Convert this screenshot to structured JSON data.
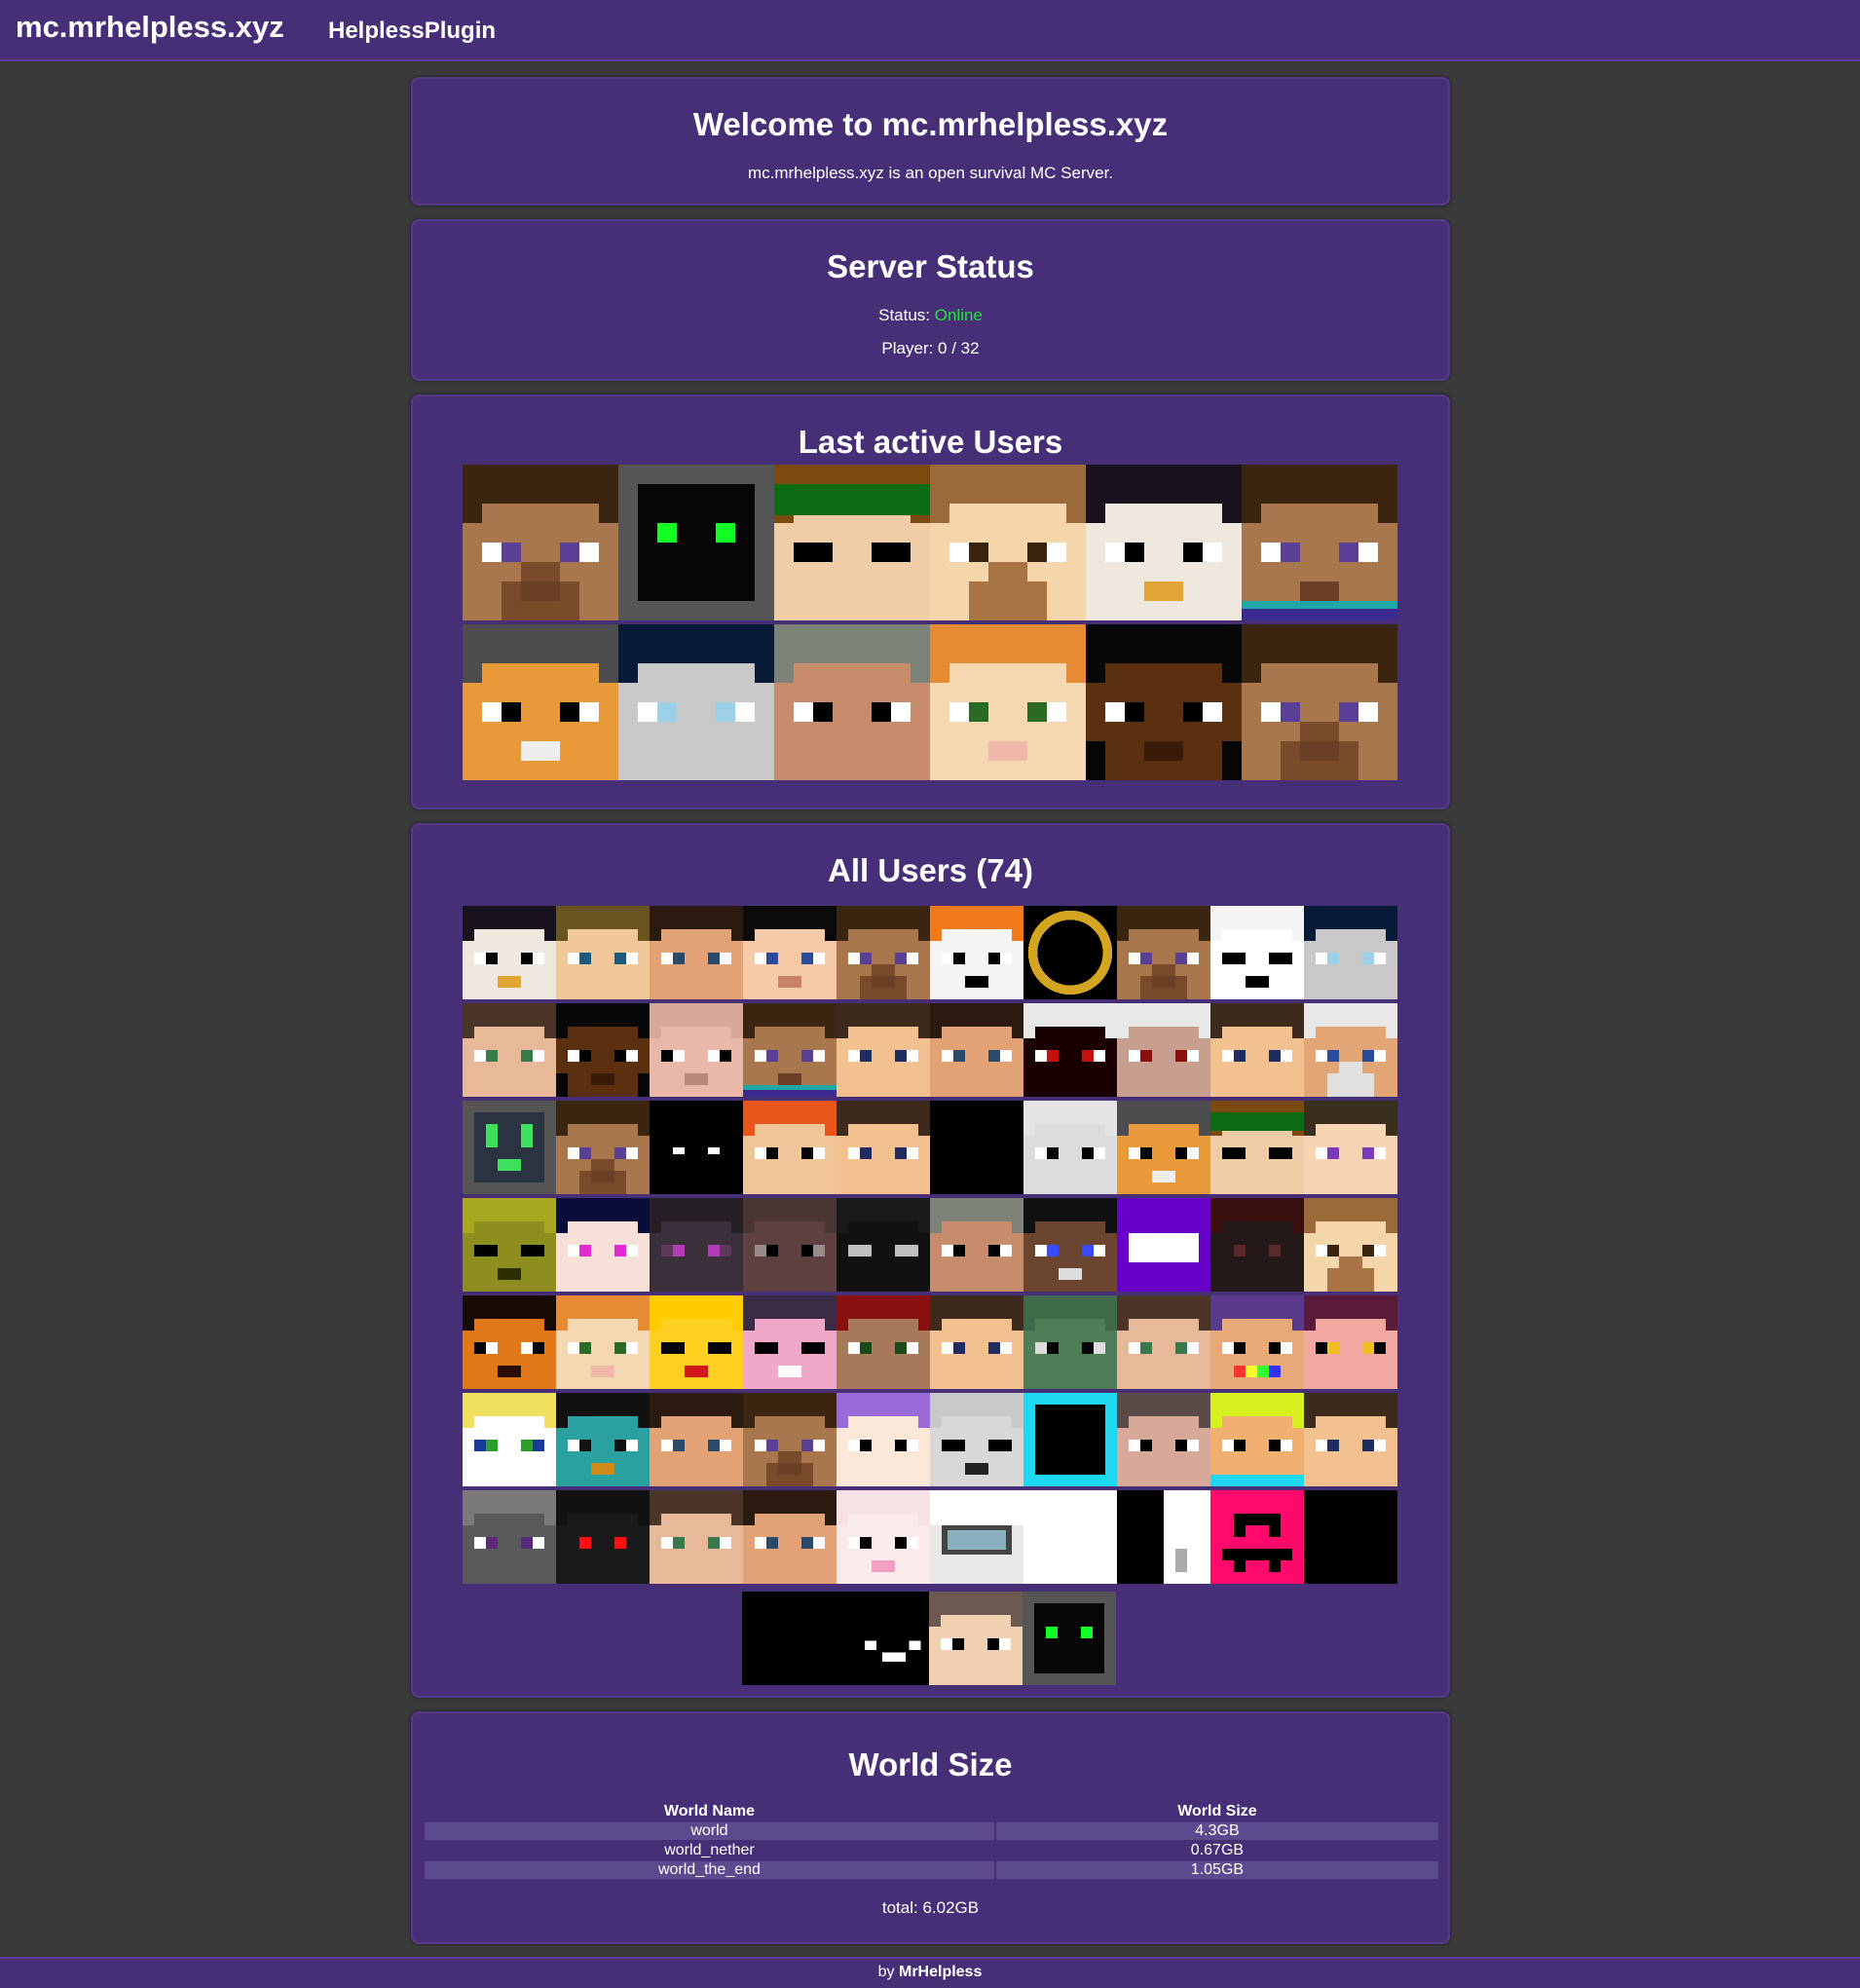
{
  "header": {
    "brand": "mc.mrhelpless.xyz",
    "nav_link": "HelplessPlugin"
  },
  "welcome": {
    "title": "Welcome to mc.mrhelpless.xyz",
    "description": "mc.mrhelpless.xyz is an open survival MC Server."
  },
  "status": {
    "title": "Server Status",
    "status_label": "Status: ",
    "status_value": "Online",
    "players": "Player: 0 / 32",
    "online_color": "#24e23f"
  },
  "last_active": {
    "title": "Last active Users",
    "faces": [
      {
        "style": "steve"
      },
      {
        "style": "creeper-dark"
      },
      {
        "style": "green-cap"
      },
      {
        "style": "blond-beard"
      },
      {
        "style": "eagle"
      },
      {
        "style": "steve-shirt"
      },
      {
        "style": "tiger"
      },
      {
        "style": "hooded-grey"
      },
      {
        "style": "grey-hair"
      },
      {
        "style": "alex"
      },
      {
        "style": "dark-skin"
      },
      {
        "style": "steve"
      }
    ]
  },
  "all_users": {
    "title": "All Users (74)",
    "count": 74,
    "faces": [
      {
        "style": "eagle"
      },
      {
        "style": "blond-boy"
      },
      {
        "style": "dark-hair"
      },
      {
        "style": "black-hair"
      },
      {
        "style": "steve"
      },
      {
        "style": "fox"
      },
      {
        "style": "ring"
      },
      {
        "style": "steve"
      },
      {
        "style": "panda"
      },
      {
        "style": "hooded-grey"
      },
      {
        "style": "brown-girl"
      },
      {
        "style": "dark-skin"
      },
      {
        "style": "pig"
      },
      {
        "style": "steve-shirt"
      },
      {
        "style": "brown-boy"
      },
      {
        "style": "dark-hair"
      },
      {
        "style": "blood"
      },
      {
        "style": "white-hair"
      },
      {
        "style": "brown-boy"
      },
      {
        "style": "old-man"
      },
      {
        "style": "robot"
      },
      {
        "style": "steve"
      },
      {
        "style": "void"
      },
      {
        "style": "orange-hair"
      },
      {
        "style": "brown-boy"
      },
      {
        "style": "black"
      },
      {
        "style": "ghost"
      },
      {
        "style": "tiger"
      },
      {
        "style": "green-cap"
      },
      {
        "style": "purple-eyes"
      },
      {
        "style": "zombie"
      },
      {
        "style": "anime"
      },
      {
        "style": "enderman-purple"
      },
      {
        "style": "dark-brown"
      },
      {
        "style": "enderman"
      },
      {
        "style": "grey-hair"
      },
      {
        "style": "dark-skin-smile"
      },
      {
        "style": "purple-box"
      },
      {
        "style": "dark-red"
      },
      {
        "style": "blond-beard"
      },
      {
        "style": "fox-dark"
      },
      {
        "style": "alex"
      },
      {
        "style": "chick"
      },
      {
        "style": "axolotl"
      },
      {
        "style": "crown"
      },
      {
        "style": "brown-boy"
      },
      {
        "style": "green-orc"
      },
      {
        "style": "brown-girl"
      },
      {
        "style": "rainbow"
      },
      {
        "style": "pink-girl"
      },
      {
        "style": "blond-green"
      },
      {
        "style": "perry"
      },
      {
        "style": "dark-hair"
      },
      {
        "style": "steve"
      },
      {
        "style": "purple-hair"
      },
      {
        "style": "wolf"
      },
      {
        "style": "cyan-box"
      },
      {
        "style": "bear"
      },
      {
        "style": "lime-hair"
      },
      {
        "style": "brown-boy"
      },
      {
        "style": "knight"
      },
      {
        "style": "red-eyes"
      },
      {
        "style": "brown-girl"
      },
      {
        "style": "dark-hair"
      },
      {
        "style": "pale-pink"
      },
      {
        "style": "goggles"
      },
      {
        "style": "white"
      },
      {
        "style": "black-white"
      },
      {
        "style": "pink-creeper"
      },
      {
        "style": "black"
      },
      {
        "style": "black"
      },
      {
        "style": "void-smile"
      },
      {
        "style": "cat"
      },
      {
        "style": "creeper-dark"
      }
    ]
  },
  "world_size": {
    "title": "World Size",
    "headers": [
      "World Name",
      "World Size"
    ],
    "rows": [
      {
        "name": "world",
        "size": "4.3GB"
      },
      {
        "name": "world_nether",
        "size": "0.67GB"
      },
      {
        "name": "world_the_end",
        "size": "1.05GB"
      }
    ],
    "total": "total: 6.02GB"
  },
  "footer": {
    "prefix": "by ",
    "author": "MrHelpless"
  }
}
